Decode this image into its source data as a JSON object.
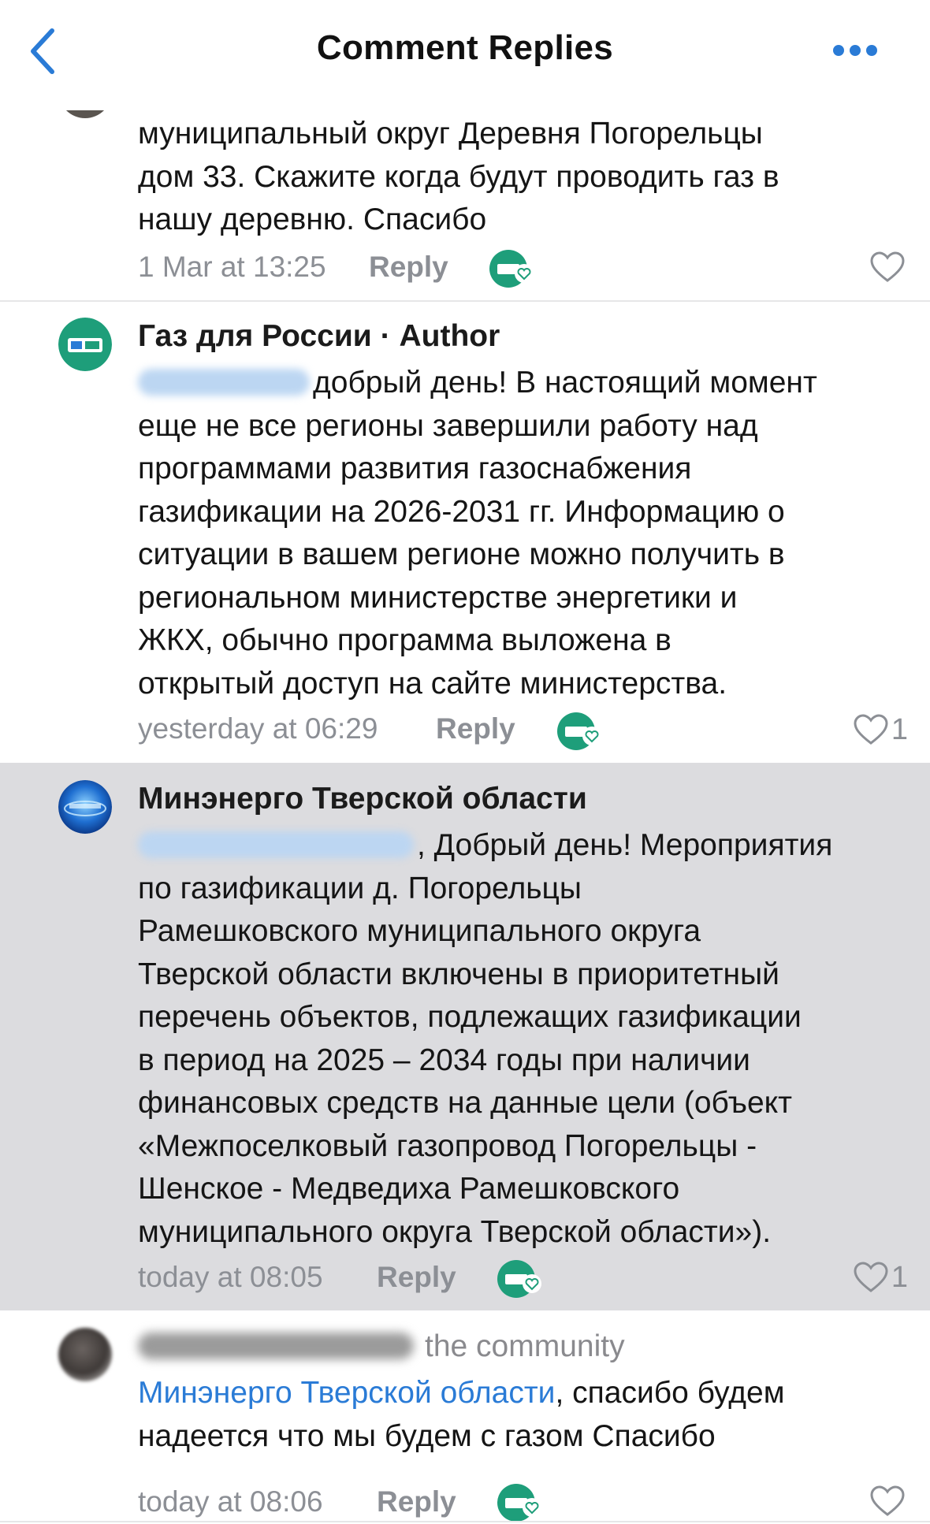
{
  "header": {
    "title": "Comment Replies",
    "back_icon": "chevron-left-icon",
    "more_icon": "more-horizontal-icon",
    "accent_color": "#2a7bd6"
  },
  "comments": [
    {
      "body_lines": [
        "муниципальный округ Деревня Погорельцы",
        "дом 33. Скажите когда будут проводить газ в",
        "нашу деревню. Спасибо"
      ],
      "time": "1 Mar at 13:25",
      "reply": "Reply",
      "likes": ""
    },
    {
      "author": "Газ для России",
      "author_badge": "· Author",
      "body_lines": [
        "добрый день! В настоящий момент",
        "еще не все регионы завершили работу над",
        "программами развития газоснабжения",
        "газификации на 2026-2031 гг. Информацию о",
        "ситуации в вашем регионе можно получить в",
        "региональном министерстве энергетики и",
        "ЖКХ, обычно программа выложена в",
        "открытый доступ на сайте министерства."
      ],
      "time": "yesterday at 06:29",
      "reply": "Reply",
      "likes": "1"
    },
    {
      "author": "Минэнерго Тверской области",
      "body_lines": [
        ", Добрый день! Мероприятия",
        "по газификации д. Погорельцы",
        "Рамешковского муниципального округа",
        "Тверской области включены в приоритетный",
        "перечень объектов, подлежащих газификации",
        "в период на 2025 – 2034 годы при наличии",
        "финансовых средств на данные цели (объект",
        "«Межпоселковый газопровод Погорельцы -",
        "Шенское - Медведиха Рамешковского",
        "муниципального округа Тверской области»)."
      ],
      "time": "today at 08:05",
      "reply": "Reply",
      "likes": "1",
      "highlight_color": "#dcdcdf"
    },
    {
      "author_suffix": "the community",
      "mention": "Минэнерго Тверской области",
      "body_lines": [
        ", спасибо будем",
        "надеется что мы будем с газом   Спасибо"
      ],
      "time": "today at 08:06",
      "reply": "Reply",
      "likes": ""
    }
  ],
  "icons": {
    "reaction": "community-reaction-icon",
    "like": "heart-outline-icon"
  }
}
